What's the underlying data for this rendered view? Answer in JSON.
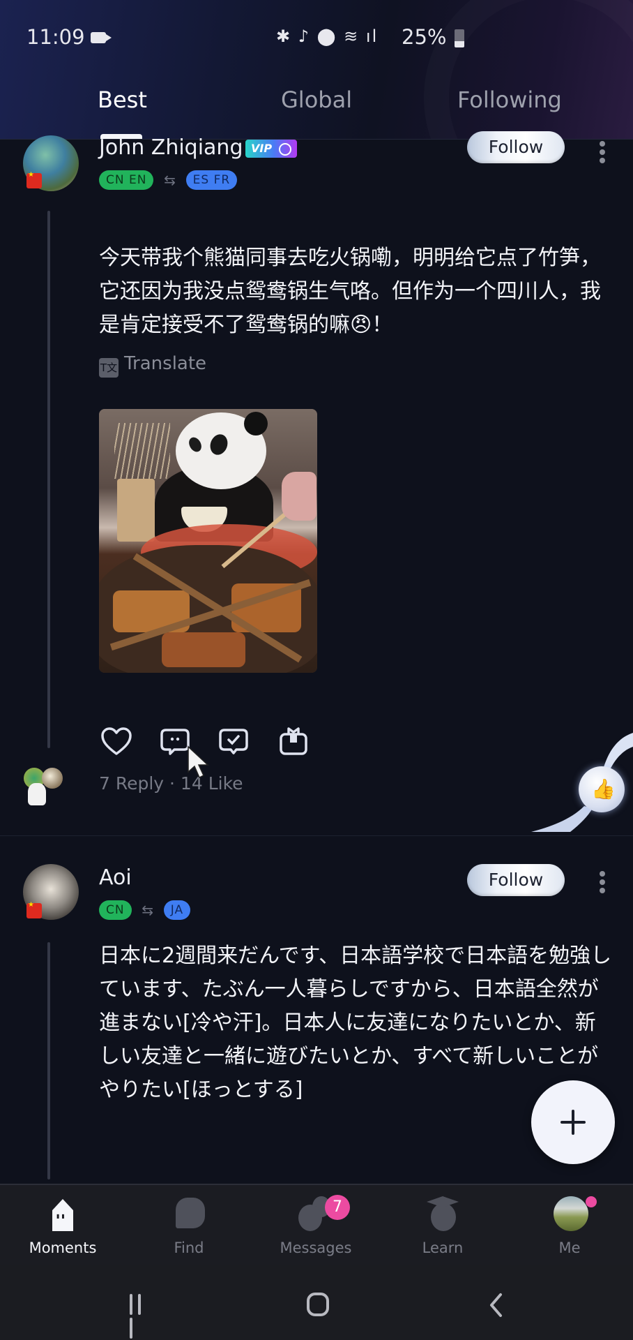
{
  "status_bar": {
    "time": "11:09",
    "icons": [
      "bluetooth-icon",
      "mute-icon",
      "location-icon",
      "wifi-icon",
      "signal-icon"
    ],
    "icons_text": "✱ ♪ ⬤ ≋ ıl",
    "battery": "25%"
  },
  "tabs": [
    {
      "label": "Best",
      "active": true
    },
    {
      "label": "Global",
      "active": false
    },
    {
      "label": "Following",
      "active": false
    }
  ],
  "posts": [
    {
      "username": "John Zhiqiang",
      "vip_label": "VIP",
      "flag": "CN",
      "native_langs": "CN  EN",
      "learning_langs": "ES  FR",
      "follow_label": "Follow",
      "text": "今天带我个熊猫同事去吃火锅嘞，明明给它点了竹笋，它还因为我没点鸳鸯锅生气咯。但作为一个四川人，我是肯定接受不了鸳鸯锅的嘛😠！",
      "translate_label": "Translate",
      "image_alt": "Panda sitting at a hot pot table",
      "stats": "7 Reply · 14 Like"
    },
    {
      "username": "Aoi",
      "flag": "CN",
      "native_langs": "CN",
      "learning_langs": "JA",
      "follow_label": "Follow",
      "text": "日本に2週間来だんです、日本語学校で日本語を勉強しています、たぶん一人暮らしですから、日本語全然が進まない[冷や汗]。日本人に友達になりたいとか、新しい友達と一緒に遊びたいとか、すべて新しいことがやりたい[ほっとする]"
    }
  ],
  "bottom_nav": [
    {
      "label": "Moments",
      "active": true
    },
    {
      "label": "Find",
      "active": false
    },
    {
      "label": "Messages",
      "active": false,
      "badge": "7"
    },
    {
      "label": "Learn",
      "active": false
    },
    {
      "label": "Me",
      "active": false
    }
  ],
  "colors": {
    "background": "#0e111c",
    "native_lang": "#21b35b",
    "learning_lang": "#3f7df2",
    "badge": "#ec4ba1"
  }
}
